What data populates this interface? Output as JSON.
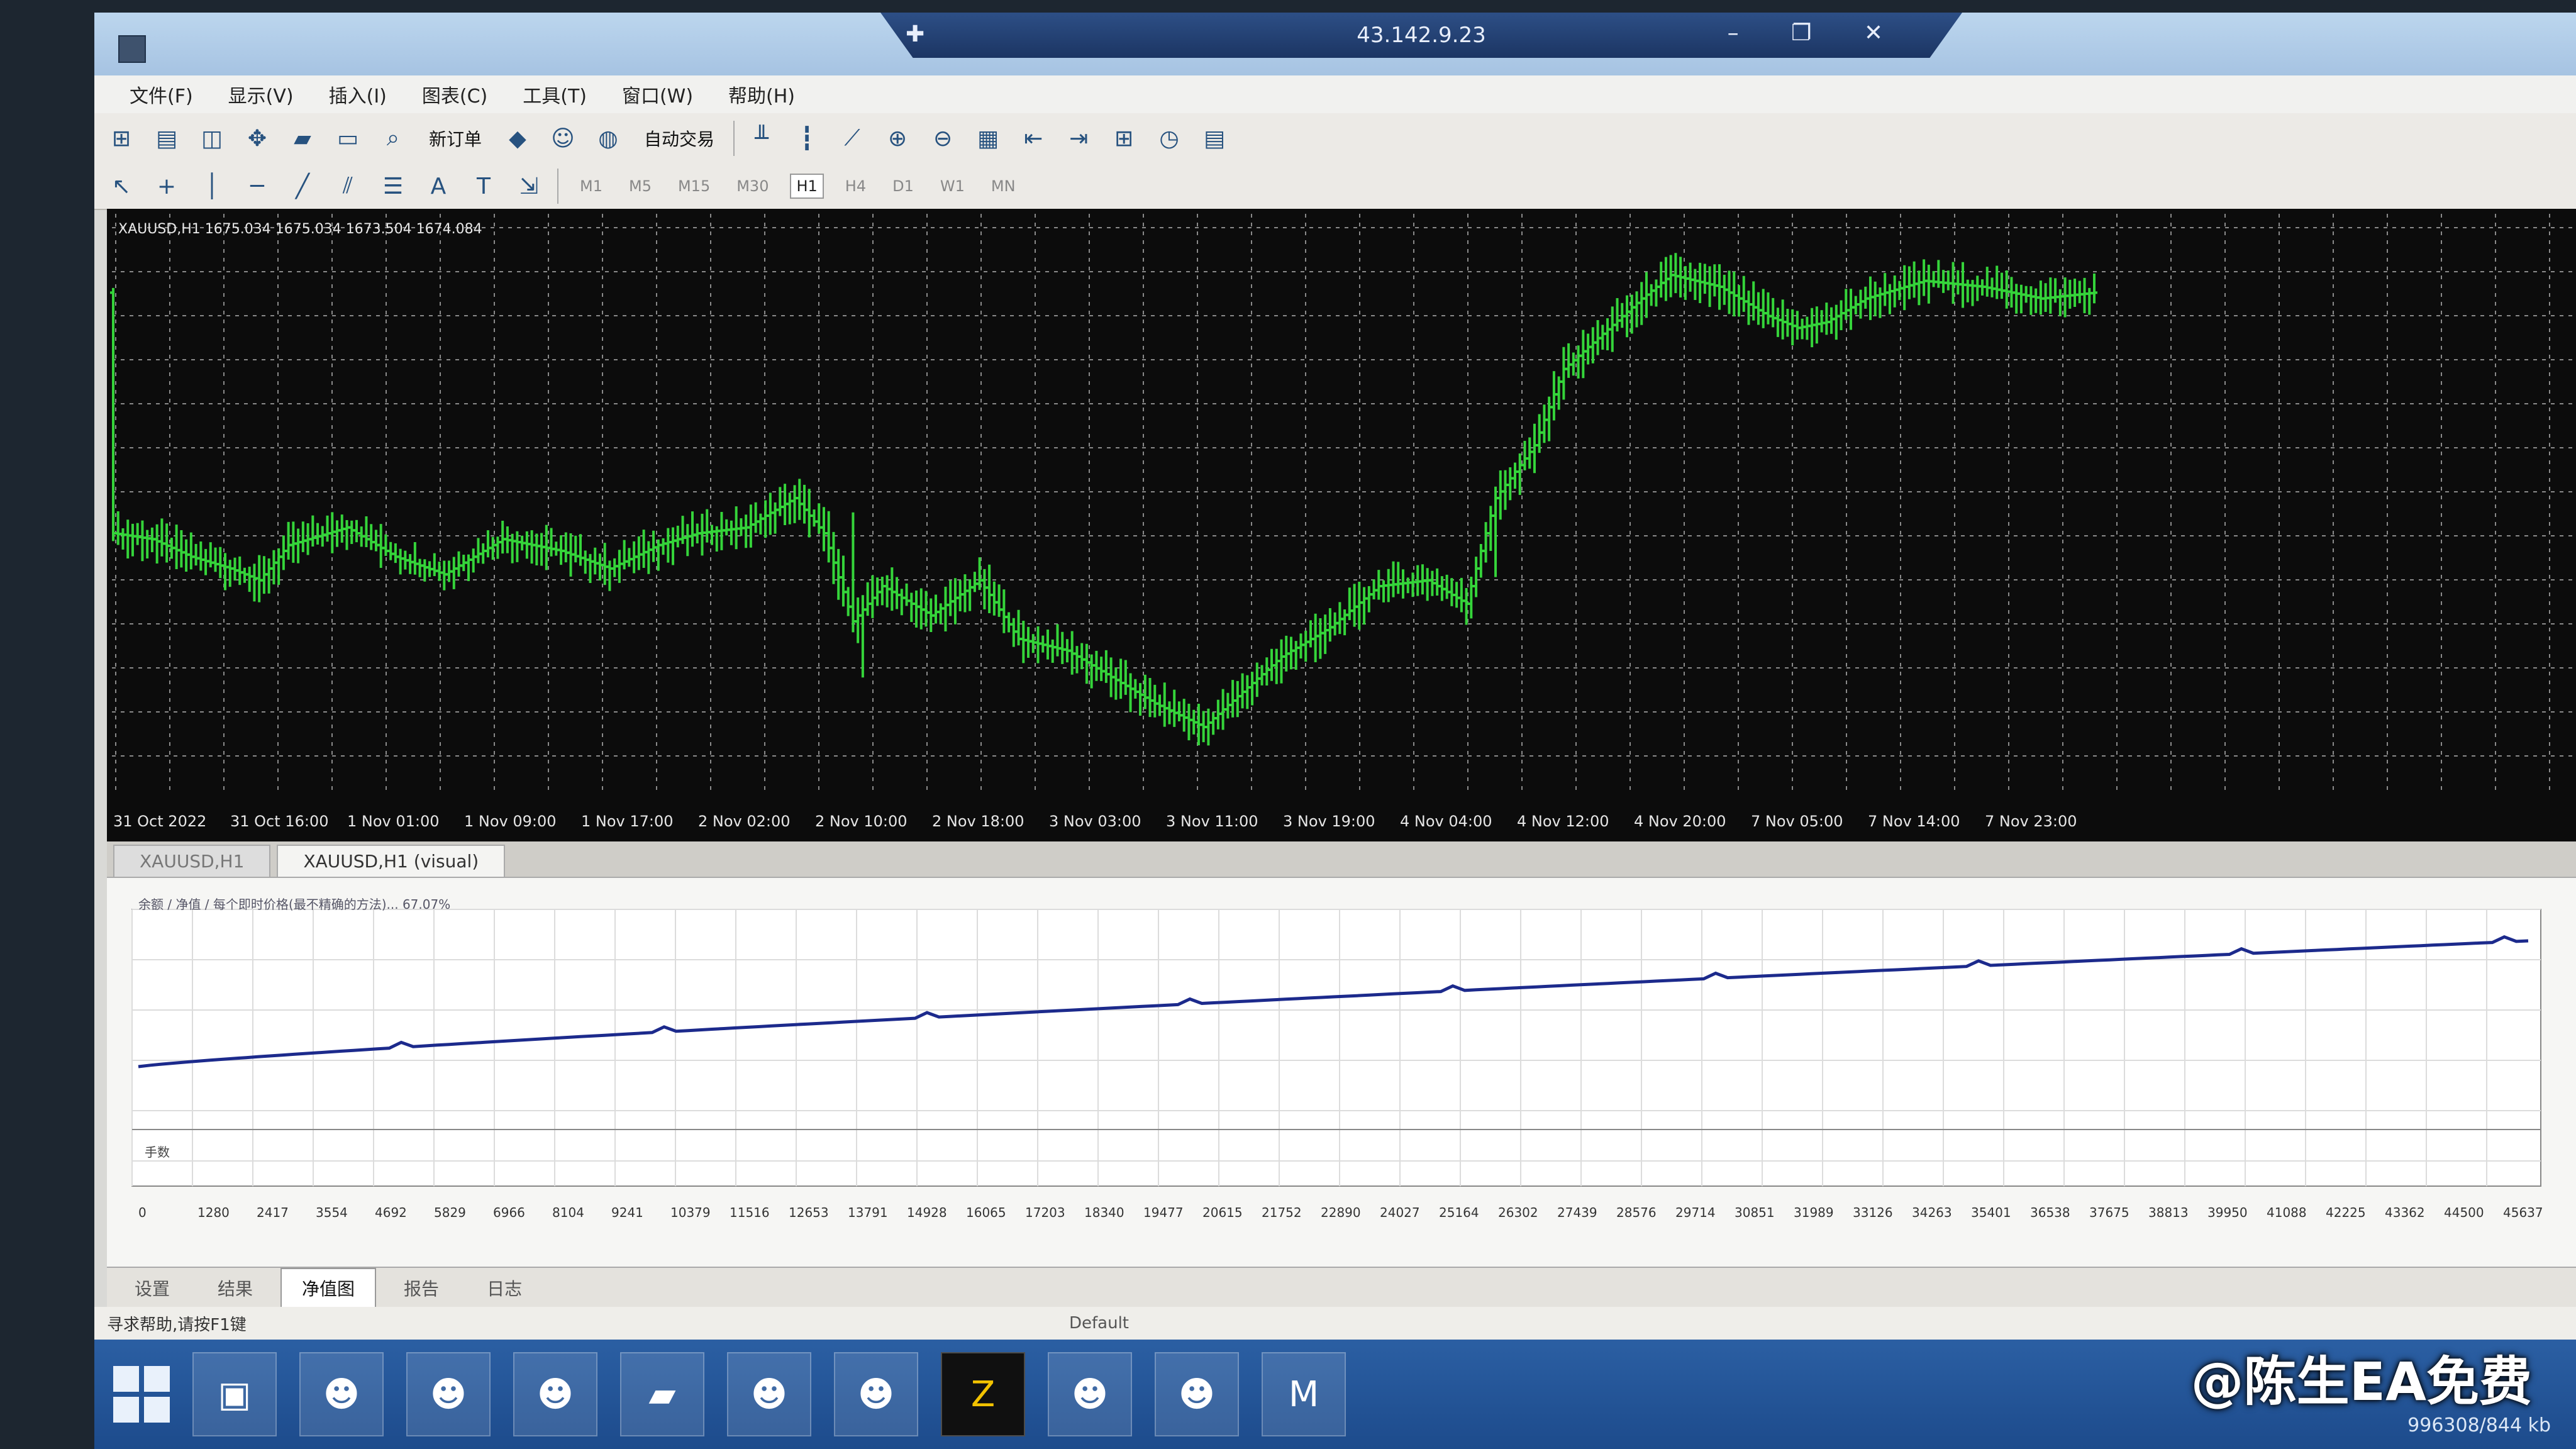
{
  "remote_bar": {
    "title": "43.142.9.23",
    "pin_icon": "pin-icon"
  },
  "menu": [
    "文件(F)",
    "显示(V)",
    "插入(I)",
    "图表(C)",
    "工具(T)",
    "窗口(W)",
    "帮助(H)"
  ],
  "toolbar": {
    "new_order": "新订单",
    "auto_trade": "自动交易"
  },
  "timeframes": [
    "M1",
    "M5",
    "M15",
    "M30",
    "H1",
    "H4",
    "D1",
    "W1",
    "MN"
  ],
  "active_timeframe": "H1",
  "chart": {
    "info": "XAUUSD,H1  1675.034 1675.034 1673.504 1674.084",
    "x_labels": [
      "31 Oct 2022",
      "31 Oct 16:00",
      "1 Nov 01:00",
      "1 Nov 09:00",
      "1 Nov 17:00",
      "2 Nov 02:00",
      "2 Nov 10:00",
      "2 Nov 18:00",
      "3 Nov 03:00",
      "3 Nov 11:00",
      "3 Nov 19:00",
      "4 Nov 04:00",
      "4 Nov 12:00",
      "4 Nov 20:00",
      "7 Nov 05:00",
      "7 Nov 14:00",
      "7 Nov 23:00"
    ],
    "bar_color": "#35d43a",
    "background": "#0c0c0c"
  },
  "chart_tabs": [
    "XAUUSD,H1",
    "XAUUSD,H1 (visual)"
  ],
  "active_chart_tab": 1,
  "tester": {
    "header": "余额 / 净值 / 每个即时价格(最不精确的方法)... 67.07%",
    "sub_label": "手数",
    "x_ticks": [
      "0",
      "1280",
      "2417",
      "3554",
      "4692",
      "5829",
      "6966",
      "8104",
      "9241",
      "10379",
      "11516",
      "12653",
      "13791",
      "14928",
      "16065",
      "17203",
      "18340",
      "19477",
      "20615",
      "21752",
      "22890",
      "24027",
      "25164",
      "26302",
      "27439",
      "28576",
      "29714",
      "30851",
      "31989",
      "33126",
      "34263",
      "35401",
      "36538",
      "37675",
      "38813",
      "39950",
      "41088",
      "42225",
      "43362",
      "44500",
      "45637"
    ],
    "line_color": "#1c2a8c"
  },
  "tester_tabs": [
    "设置",
    "结果",
    "净值图",
    "报告",
    "日志"
  ],
  "active_tester_tab": 2,
  "status": {
    "left": "寻求帮助,请按F1键",
    "profile": "Default",
    "tray": "996308/844 kb"
  },
  "watermark": "@陈生EA免费"
}
